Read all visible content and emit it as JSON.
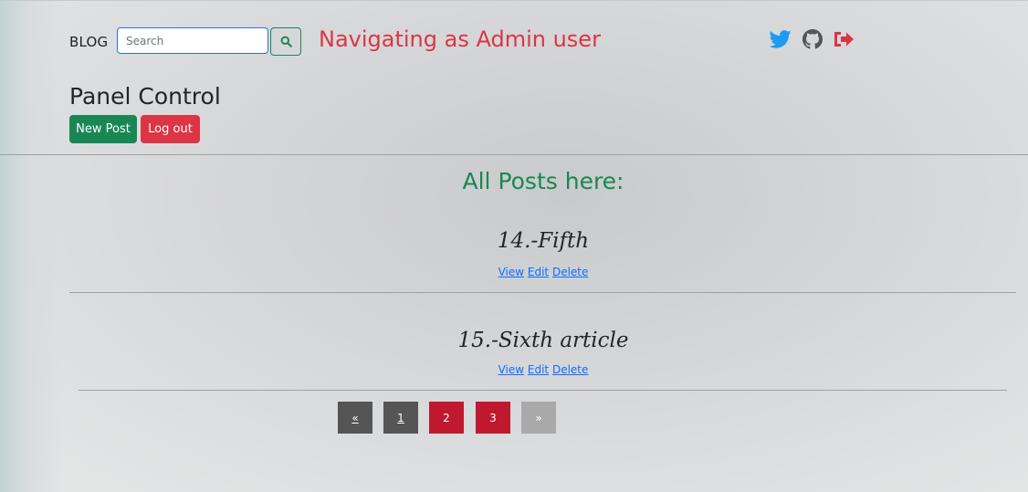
{
  "header": {
    "brand": "BLOG",
    "search": {
      "placeholder": "Search",
      "value": ""
    },
    "admin_message": "Navigating as Admin user",
    "icons": [
      "twitter-icon",
      "github-icon",
      "sign-out-icon"
    ]
  },
  "panel": {
    "title": "Panel Control",
    "new_post_label": "New Post",
    "logout_label": "Log out"
  },
  "posts_section": {
    "title": "All Posts here:",
    "posts": [
      {
        "title": "14.-Fifth",
        "actions": [
          "View",
          "Edit",
          "Delete"
        ]
      },
      {
        "title": "15.-Sixth article",
        "actions": [
          "View",
          "Edit",
          "Delete"
        ]
      }
    ]
  },
  "pagination": {
    "prev": "«",
    "pages": [
      "1",
      "2",
      "3"
    ],
    "current": "1",
    "next": "»"
  },
  "colors": {
    "accent_green": "#198754",
    "accent_red": "#dc3545",
    "twitter_blue": "#1d9bf0",
    "link_blue": "#0d6efd"
  }
}
